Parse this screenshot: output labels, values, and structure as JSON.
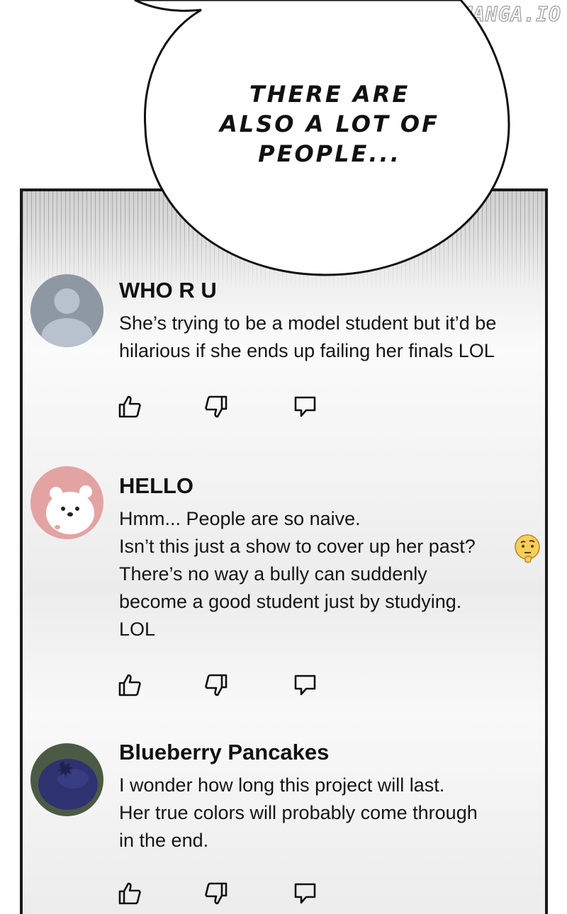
{
  "watermark": "LIKEMANGA.IO",
  "speech_bubble": {
    "lines": [
      "THERE ARE",
      "ALSO A LOT OF",
      "PEOPLE..."
    ]
  },
  "comments": [
    {
      "username": "WHO R U",
      "avatar": "default-user-avatar",
      "lines": [
        "She’s trying to be a model student but it’d be",
        "hilarious if she ends up failing her finals LOL"
      ],
      "actions": [
        "thumbs-up-icon",
        "thumbs-down-icon",
        "reply-icon"
      ]
    },
    {
      "username": "HELLO",
      "avatar": "polar-bear-avatar",
      "lines": [
        "Hmm... People are so naive.",
        "Isn’t this just a show to cover up her past?",
        "There’s no way a bully can suddenly",
        "become a good student just by studying.",
        "LOL"
      ],
      "emoji": "thinking-face-emoji",
      "actions": [
        "thumbs-up-icon",
        "thumbs-down-icon",
        "reply-icon"
      ]
    },
    {
      "username": "Blueberry Pancakes",
      "avatar": "blueberry-avatar",
      "lines": [
        "I wonder how long this project will last.",
        "Her true colors will probably come through",
        "in the end."
      ],
      "actions": [
        "thumbs-up-icon",
        "thumbs-down-icon",
        "reply-icon"
      ]
    }
  ],
  "colors": {
    "panel_border": "#1a1a1a",
    "default_avatar_bg": "#8e98a3",
    "bear_avatar_bg": "#e4a3a3",
    "blueberry_avatar_bg": "#4b5a45",
    "blueberry": "#2f3270"
  }
}
